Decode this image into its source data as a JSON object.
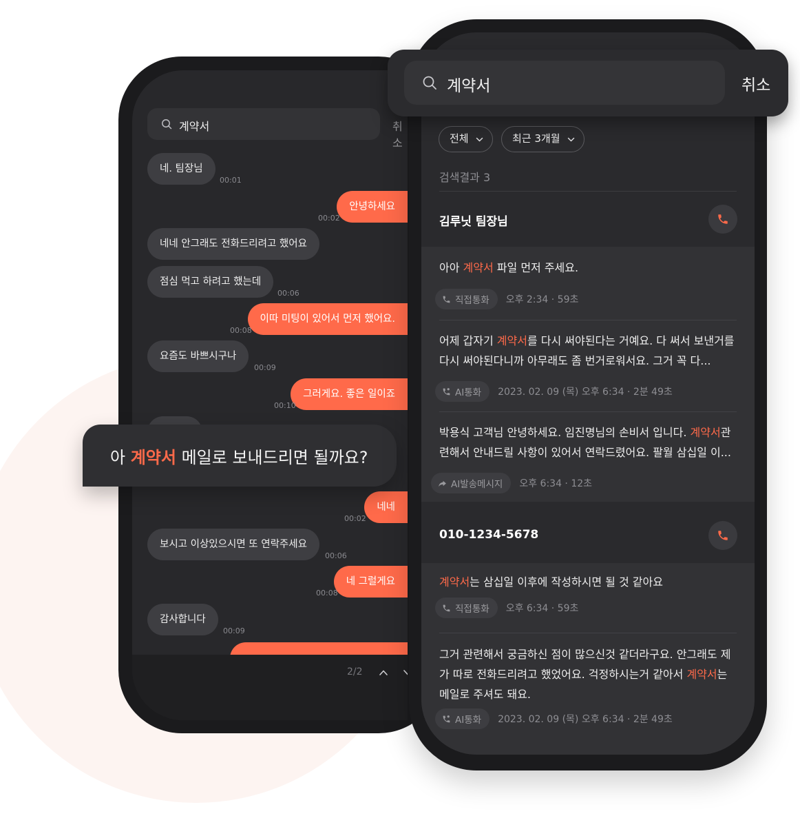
{
  "colors": {
    "accent": "#ff6a4a",
    "phone": "#1b1b1d",
    "screen": "#28282b"
  },
  "back_phone": {
    "search_query": "계약서",
    "cancel_label": "취소",
    "messages": [
      {
        "text": "네. 팀장님",
        "time": "00:01"
      },
      {
        "text": "안녕하세요",
        "time": "00:02"
      },
      {
        "text": "네네 안그래도 전화드리려고 했어요",
        "time": ""
      },
      {
        "text": "점심 먹고 하려고 했는데",
        "time": "00:06"
      },
      {
        "text": "이따 미팅이 있어서 먼저 했어요.",
        "time": "00:08"
      },
      {
        "text": "요즘도 바쁘시구나",
        "time": "00:09"
      },
      {
        "text": "그러게요. 좋은 일이죠",
        "time": "00:10"
      },
      {
        "text": "네네",
        "time": "00:02"
      },
      {
        "text": "보시고 이상있으시면 또 연락주세요",
        "time": "00:06"
      },
      {
        "text": "네 그럴게요",
        "time": "00:08"
      },
      {
        "text": "감사합니다",
        "time": "00:09"
      }
    ],
    "page_indicator": "2/2"
  },
  "callout": {
    "prefix": "아 ",
    "highlight": "계약서",
    "suffix": " 메일로 보내드리면 될까요?"
  },
  "front_phone": {
    "search_query": "계약서",
    "cancel_label": "취소",
    "filters": {
      "scope": "전체",
      "period": "최근 3개월"
    },
    "result_count": "검색결과 3",
    "groups": [
      {
        "name": "김루닛 팀장님",
        "items": [
          {
            "pre": "아아 ",
            "hl": "계약서",
            "post": " 파일 먼저 주세요.",
            "tag": "직접통화",
            "info": "오후 2:34 · 59초"
          },
          {
            "pre": "어제 갑자기 ",
            "hl": "계약서",
            "post": "를 다시 써야된다는 거예요. 다 써서 보낸거를 다시 써야된다니까 아무래도 좀 번거로워서요. 그거 꼭 다...",
            "tag": "AI통화",
            "info": "2023. 02. 09 (목) 오후 6:34 · 2분 49초"
          },
          {
            "pre": "박용식 고객님 안녕하세요. 임진명님의 손비서 입니다. ",
            "hl": "계약서",
            "post": "관련해서 안내드릴 사항이 있어서 연락드렸어요. 팔월 삼십일 이...",
            "tag": "AI발송메시지",
            "info": "오후 6:34 · 12초"
          }
        ]
      },
      {
        "name": "010-1234-5678",
        "items": [
          {
            "pre": "",
            "hl": "계약서",
            "post": "는 삼십일 이후에 작성하시면 될 것 같아요",
            "tag": "직접통화",
            "info": "오후 6:34 · 59초"
          },
          {
            "pre": "그거 관련해서 궁금하신 점이 많으신것 같더라구요. 안그래도 제가 따로 전화드리려고 했었어요. 걱정하시는거 같아서 ",
            "hl": "계약서",
            "post": "는 메일로 주셔도 돼요.",
            "tag": "AI통화",
            "info": "2023. 02. 09 (목) 오후 6:34 · 2분 49초"
          }
        ]
      }
    ]
  }
}
